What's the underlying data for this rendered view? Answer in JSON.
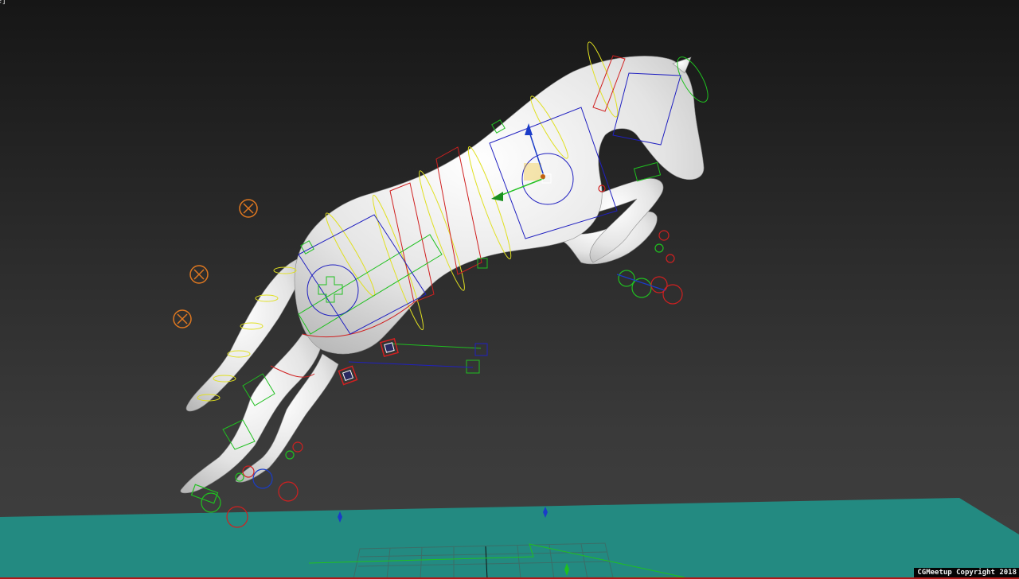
{
  "viewport": {
    "label": "e]",
    "background_top": "#161616",
    "background_bottom": "#404040",
    "ground_color": "#27968c",
    "horse_color": "#e6e6e6"
  },
  "overlay": {
    "copyright": "CGMeetup Copyright 2018"
  },
  "rig_control_colors": {
    "spine": "#e0e020",
    "left_side": "#20c020",
    "right_side": "#d02020",
    "center": "#2020c0",
    "tail_helpers": "#e07820",
    "selected": "#f0c020"
  },
  "icons": [
    "gizmo-arrow-icon",
    "circle-crosshair-icon",
    "square-control-icon"
  ]
}
